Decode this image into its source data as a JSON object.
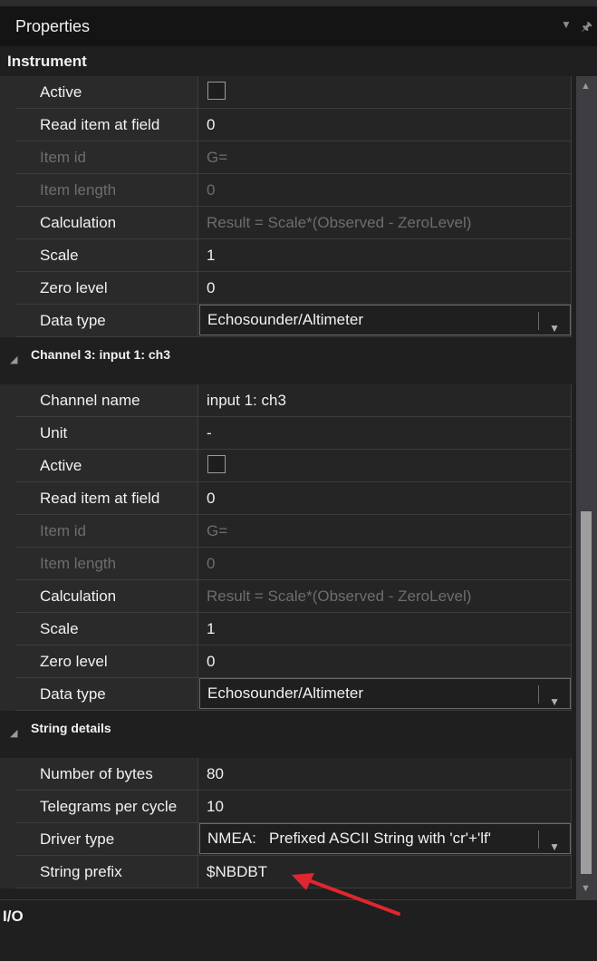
{
  "window": {
    "title": "Properties",
    "menu_icon": "dropdown-arrow-icon",
    "pin_icon": "pin-icon"
  },
  "sections": {
    "instrument": "Instrument",
    "io": "I/O"
  },
  "instrument_rows": [
    {
      "name": "Active",
      "type": "checkbox",
      "checked": false
    },
    {
      "name": "Read item at field",
      "value": "0"
    },
    {
      "name": "Item id",
      "value": "G=",
      "disabled": true
    },
    {
      "name": "Item length",
      "value": "0",
      "disabled": true
    },
    {
      "name": "Calculation",
      "value": "Result = Scale*(Observed - ZeroLevel)",
      "value_dim": true
    },
    {
      "name": "Scale",
      "value": "1"
    },
    {
      "name": "Zero level",
      "value": "0"
    },
    {
      "name": "Data type",
      "type": "dropdown",
      "value": "Echosounder/Altimeter"
    }
  ],
  "channel3": {
    "label": "Channel 3: input 1: ch3",
    "rows": [
      {
        "name": "Channel name",
        "value": "input 1: ch3"
      },
      {
        "name": "Unit",
        "value": "-"
      },
      {
        "name": "Active",
        "type": "checkbox",
        "checked": false
      },
      {
        "name": "Read item at field",
        "value": "0"
      },
      {
        "name": "Item id",
        "value": "G=",
        "disabled": true
      },
      {
        "name": "Item length",
        "value": "0",
        "disabled": true
      },
      {
        "name": "Calculation",
        "value": "Result = Scale*(Observed - ZeroLevel)",
        "value_dim": true
      },
      {
        "name": "Scale",
        "value": "1"
      },
      {
        "name": "Zero level",
        "value": "0"
      },
      {
        "name": "Data type",
        "type": "dropdown",
        "value": "Echosounder/Altimeter"
      }
    ]
  },
  "string_details": {
    "label": "String details",
    "rows": [
      {
        "name": "Number of bytes",
        "value": "80"
      },
      {
        "name": "Telegrams per cycle",
        "value": "10"
      },
      {
        "name": "Driver type",
        "type": "dropdown",
        "value": "NMEA:   Prefixed ASCII String with 'cr'+'lf'"
      },
      {
        "name": "String prefix",
        "value": "$NBDBT"
      }
    ]
  },
  "colors": {
    "annotation_arrow": "#e0262e"
  }
}
